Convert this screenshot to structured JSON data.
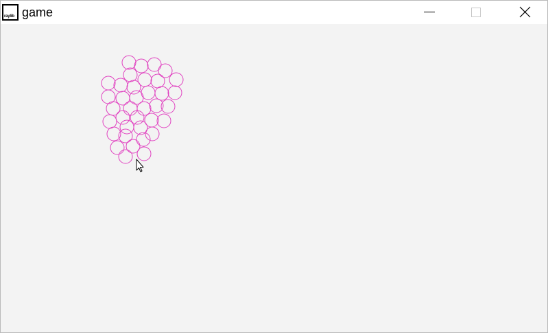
{
  "window": {
    "title": "game",
    "icon_label": "raylib",
    "controls": {
      "minimize_icon": "minimize-icon",
      "maximize_icon": "maximize-icon",
      "close_icon": "close-icon"
    }
  },
  "canvas": {
    "background_color": "#f3f3f3",
    "circle_color": "#e040c0",
    "circle_count": 42
  }
}
